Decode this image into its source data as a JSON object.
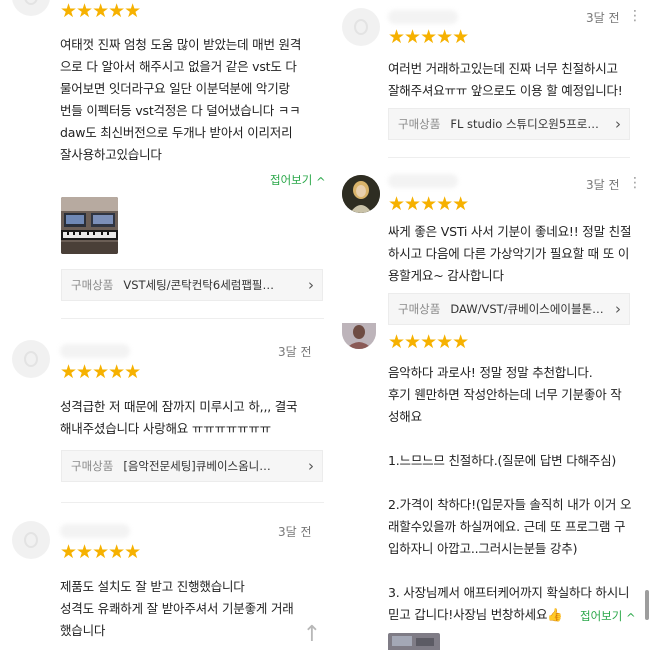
{
  "common": {
    "stars": "★★★★★",
    "product_label": "구매상품",
    "collapse_label": "접어보기",
    "collapse_chevron": "^",
    "chevron": "›",
    "more_dots": "⋮",
    "scroll_top_arrow": "↑",
    "rating": 5
  },
  "reviews": [
    {
      "time": "",
      "text": "여태껏 진짜 엄청 도움 많이 받았는데 매번 원격\n으로 다 알아서 해주시고 없을거 같은 vst도 다\n물어보면 잇더라구요 일단 이분덕분에 악기랑\n번들 이펙터등 vst걱정은 다 덜어냈습니다 ㅋㅋ\ndaw도 최신버전으로 두개나 받아서 이리저리\n잘사용하고있습니다",
      "product": "VST세팅/콘탁컨탁6세럼팹필…"
    },
    {
      "time": "3달 전",
      "text": "성격급한 저 때문에 잠까지 미루시고 하,,, 결국\n해내주셨습니다 사랑해요 ㅠㅠㅠㅠㅠㅠㅠ",
      "product": "[음악전문세팅]큐베이스옴니…"
    },
    {
      "time": "3달 전",
      "text": "제품도 설치도 잘 받고 진행했습니다\n성격도 유쾌하게 잘 받아주셔서 기분좋게 거래\n했습니다",
      "product": ""
    },
    {
      "time": "3달 전",
      "text": "여러번 거래하고있는데 진짜 너무 친절하시고\n잘해주셔요ㅠㅠ 앞으로도 이용 할 예정입니다!",
      "product": "FL studio 스튜디오원5프로…"
    },
    {
      "time": "3달 전",
      "text": "싸게 좋은 VSTi 사서 기분이 좋네요!! 정말 친절\n하시고 다음에 다른 가상악기가 필요할 때 또 이\n용할게요~ 감사합니다",
      "product": "DAW/VST/큐베이스에이블톤…"
    },
    {
      "time": "",
      "text": "음악하다 과로사! 정말 정말 추천합니다.\n후기 웬만하면 작성안하는데 너무 기분좋아 작\n성해요\n\n1.느므느므 친절하다.(질문에 답변 다해주심)\n\n2.가격이 착하다!(입문자들 솔직히 내가 이거 오\n래할수있을까 하실꺼에요. 근데 또 프로그램 구\n입하자니 아깝고..그러시는분들 강추)\n\n3. 사장님께서 애프터케어까지 확실하다 하시니\n믿고 갑니다!사장님 번창하세요👍",
      "product": ""
    }
  ]
}
